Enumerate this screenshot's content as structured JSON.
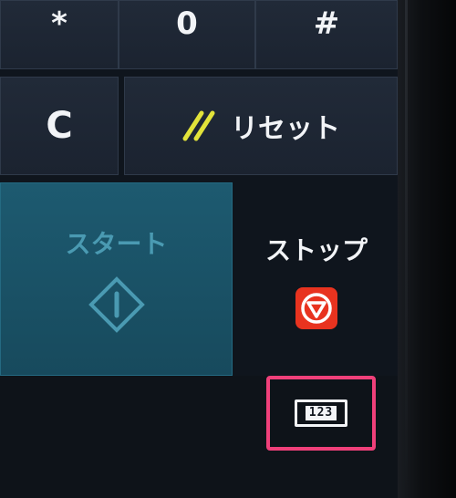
{
  "keypad": {
    "star": "*",
    "zero": "0",
    "hash": "#",
    "clear": "C",
    "reset": "リセット",
    "start": "スタート",
    "stop": "ストップ",
    "numkeys": "123"
  },
  "colors": {
    "panel": "#0f151d",
    "key": "#1f2835",
    "start_key": "#1b5468",
    "reset_slashes": "#e2e33a",
    "stop_badge": "#e8331f",
    "highlight": "#f0407a"
  }
}
